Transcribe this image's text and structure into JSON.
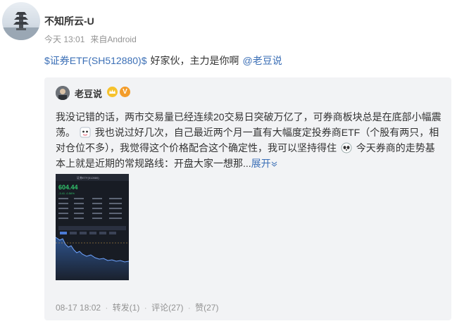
{
  "post": {
    "username": "不知所云-U",
    "time": "今天 13:01",
    "source_prefix": "来自",
    "source": "Android",
    "stock_link": "$证券ETF(SH512880)$",
    "message": "好家伙，主力是你啊",
    "mention": "@老豆说"
  },
  "repost": {
    "author": "老豆说",
    "text_part1": "我没记错的话，两市交易量已经连续20交易日突破万亿了，可券商板块总是在底部小幅震荡。",
    "text_part2": "我也说过好几次，自己最近两个月一直有大幅度定投券商ETF（个股有两只，相对仓位不多），我觉得这个价格配合这个确定性，我可以坚持得住",
    "text_part3": "今天券商的走势基本上就是近期的常规路线：开盘大家一想那...",
    "expand_label": "展开",
    "thumbnail": {
      "title": "证券ETF(512880)",
      "price": "604.44",
      "change": "-3.41 -0.56%"
    },
    "footer": {
      "date": "08-17 18:02",
      "repost_label": "转发(1)",
      "comment_label": "评论(27)",
      "like_label": "赞(27)"
    }
  },
  "colors": {
    "link": "#3b6fb6",
    "meta_text": "#939393",
    "card_background": "#f2f3f5",
    "chart_line": "#3f7fe0"
  }
}
